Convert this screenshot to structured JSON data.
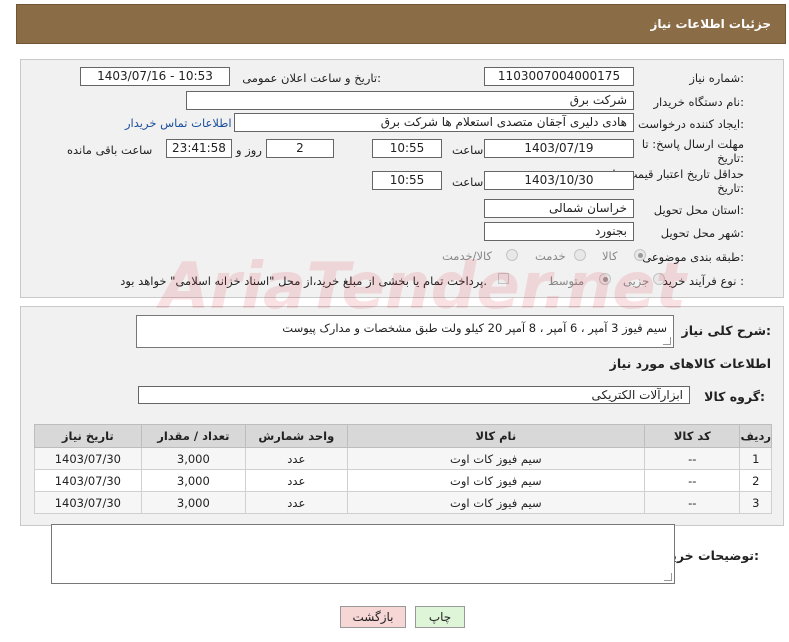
{
  "header": {
    "title": "جزئیات اطلاعات نیاز"
  },
  "fields": {
    "need_number_label": "شماره نیاز:",
    "need_number": "1103007004000175",
    "announce_label": "تاریخ و ساعت اعلان عمومی:",
    "announce_value": "1403/07/16 - 10:53",
    "buyer_org_label": "نام دستگاه خریدار:",
    "buyer_org": "شرکت برق",
    "creator_label": "ایجاد کننده درخواست:",
    "creator": "هادی دلیری آجقان متصدی استعلام ها  شرکت برق",
    "contact_link": "اطلاعات تماس خریدار",
    "deadline_label_1": "مهلت ارسال پاسخ: تا",
    "deadline_label_2": "تاریخ:",
    "deadline_date": "1403/07/19",
    "time_label": "ساعت",
    "deadline_time": "10:55",
    "days_value": "2",
    "days_label": "روز و",
    "remaining_value": "23:41:58",
    "remaining_label": "ساعت باقی مانده",
    "validity_label_1": "حداقل تاریخ اعتبار قیمت: تا",
    "validity_label_2": "تاریخ:",
    "validity_date": "1403/10/30",
    "validity_time": "10:55",
    "province_label": "استان محل تحویل:",
    "province": "خراسان شمالی",
    "city_label": "شهر محل تحویل:",
    "city": "بجنورد",
    "category_label": "طبقه بندی موضوعی:",
    "category_options": [
      "کالا",
      "خدمت",
      "کالا/خدمت"
    ],
    "process_label": "نوع فرآیند خرید :",
    "process_options": [
      "جزیی",
      "متوسط"
    ],
    "payment_note": "پرداخت تمام یا بخشی از مبلغ خرید،از محل \"اسناد خزانه اسلامی\" خواهد بود."
  },
  "description": {
    "label": "شرح کلی نیاز:",
    "text": "سیم فیوز 3 آمپر ، 6 آمپر ، 8 آمپر 20 کیلو ولت طبق مشخصات و مدارک پیوست"
  },
  "goods": {
    "section_title": "اطلاعات کالاهای مورد نیاز",
    "group_label": "گروه کالا:",
    "group_value": "ابزارآلات الکتریکی",
    "columns": [
      "ردیف",
      "کد کالا",
      "نام کالا",
      "واحد شمارش",
      "تعداد / مقدار",
      "تاریخ نیاز"
    ],
    "rows": [
      {
        "idx": "1",
        "code": "--",
        "name": "سیم فیوز کات اوت",
        "unit": "عدد",
        "qty": "3,000",
        "date": "1403/07/30"
      },
      {
        "idx": "2",
        "code": "--",
        "name": "سیم فیوز کات اوت",
        "unit": "عدد",
        "qty": "3,000",
        "date": "1403/07/30"
      },
      {
        "idx": "3",
        "code": "--",
        "name": "سیم فیوز کات اوت",
        "unit": "عدد",
        "qty": "3,000",
        "date": "1403/07/30"
      }
    ]
  },
  "buyer_notes": {
    "label": "توضیحات خریدار:",
    "text": ""
  },
  "buttons": {
    "print": "چاپ",
    "back": "بازگشت"
  },
  "watermark": "AriaTender.net",
  "colors": {
    "header_bg": "#8a6d47",
    "print_btn": "#dff5d8",
    "back_btn": "#f7d6d6"
  }
}
